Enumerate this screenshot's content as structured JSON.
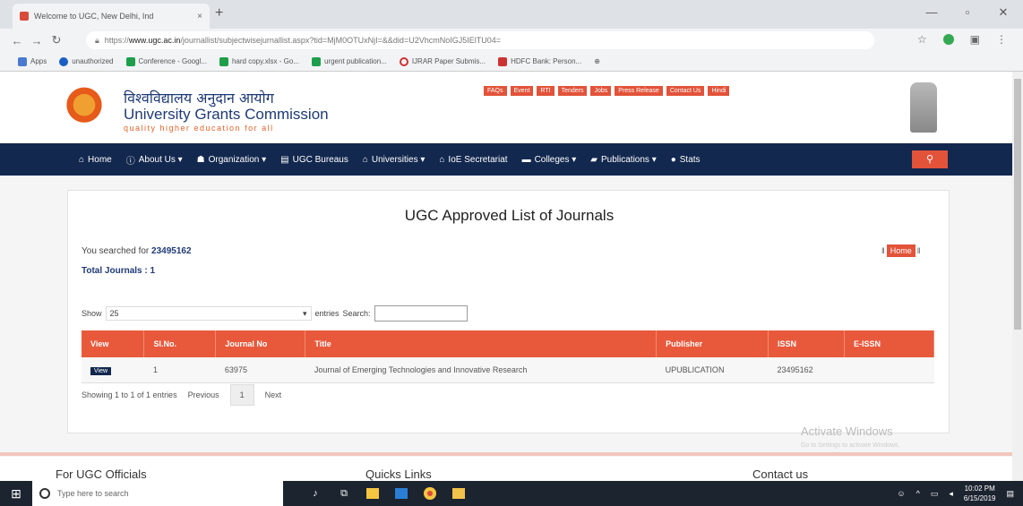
{
  "browser": {
    "tab_title": "Welcome to UGC, New Delhi, Ind",
    "tab_close": "×",
    "new_tab": "+",
    "url_prefix": "https://",
    "url_host": "www.ugc.ac.in",
    "url_path": "/journallist/subjectwisejurnallist.aspx?tid=MjM0OTUxNjI=&&did=U2VhcmNoIGJ5IElTU04=",
    "bookmarks": [
      "Apps",
      "unauthorized",
      "Conference - Googl...",
      "hard copy.xlsx - Go...",
      "urgent publication...",
      "IJRAR Paper Submis...",
      "HDFC Bank: Person..."
    ]
  },
  "site": {
    "hindi_name": "विश्वविद्यालय अनुदान आयोग",
    "english_name": "University Grants Commission",
    "tagline": "quality higher education for all",
    "top_links": [
      "FAQs",
      "Event",
      "RTI",
      "Tenders",
      "Jobs",
      "Press Release",
      "Contact Us",
      "Hindi"
    ],
    "nav": [
      {
        "label": "Home",
        "icon": "home-icon",
        "glyph": "⌂"
      },
      {
        "label": "About Us ▾",
        "icon": "info-icon",
        "glyph": "ⓘ"
      },
      {
        "label": "Organization ▾",
        "icon": "org-icon",
        "glyph": "☗"
      },
      {
        "label": "UGC Bureaus",
        "icon": "list-icon",
        "glyph": "▤"
      },
      {
        "label": "Universities ▾",
        "icon": "university-icon",
        "glyph": "⌂"
      },
      {
        "label": "IoE Secretariat",
        "icon": "university-icon",
        "glyph": "⌂"
      },
      {
        "label": "Colleges ▾",
        "icon": "graduation-icon",
        "glyph": "▬"
      },
      {
        "label": "Publications ▾",
        "icon": "book-icon",
        "glyph": "▰"
      },
      {
        "label": "Stats",
        "icon": "pie-chart-icon",
        "glyph": "●"
      }
    ],
    "search_glyph": "⚲"
  },
  "content": {
    "title": "UGC Approved List of Journals",
    "searched_label": "You searched for ",
    "searched_value": "23495162",
    "total_journals": "Total Journals : 1",
    "home_button": "Home",
    "show_label": "Show",
    "show_value": "25",
    "entries_label": "entries",
    "search_label": "Search:",
    "search_value": "",
    "table": {
      "headers": [
        "View",
        "Sl.No.",
        "Journal No",
        "Title",
        "Publisher",
        "ISSN",
        "E-ISSN"
      ],
      "rows": [
        {
          "view": "View",
          "sl": "1",
          "journal_no": "63975",
          "title": "Journal of Emerging Technologies and Innovative Research",
          "publisher": "UPUBLICATION",
          "issn": "23495162",
          "eissn": ""
        }
      ]
    },
    "showing": "Showing 1 to 1 of 1 entries",
    "previous": "Previous",
    "page": "1",
    "next": "Next"
  },
  "footer": {
    "col1": "For UGC Officials",
    "col2": "Quicks Links",
    "col3": "Contact us"
  },
  "overlay": {
    "activate": "Activate Windows",
    "activate_sub": "Go to Settings to activate Windows."
  },
  "taskbar": {
    "search_placeholder": "Type here to search",
    "time": "10:02 PM",
    "date": "6/15/2019"
  }
}
